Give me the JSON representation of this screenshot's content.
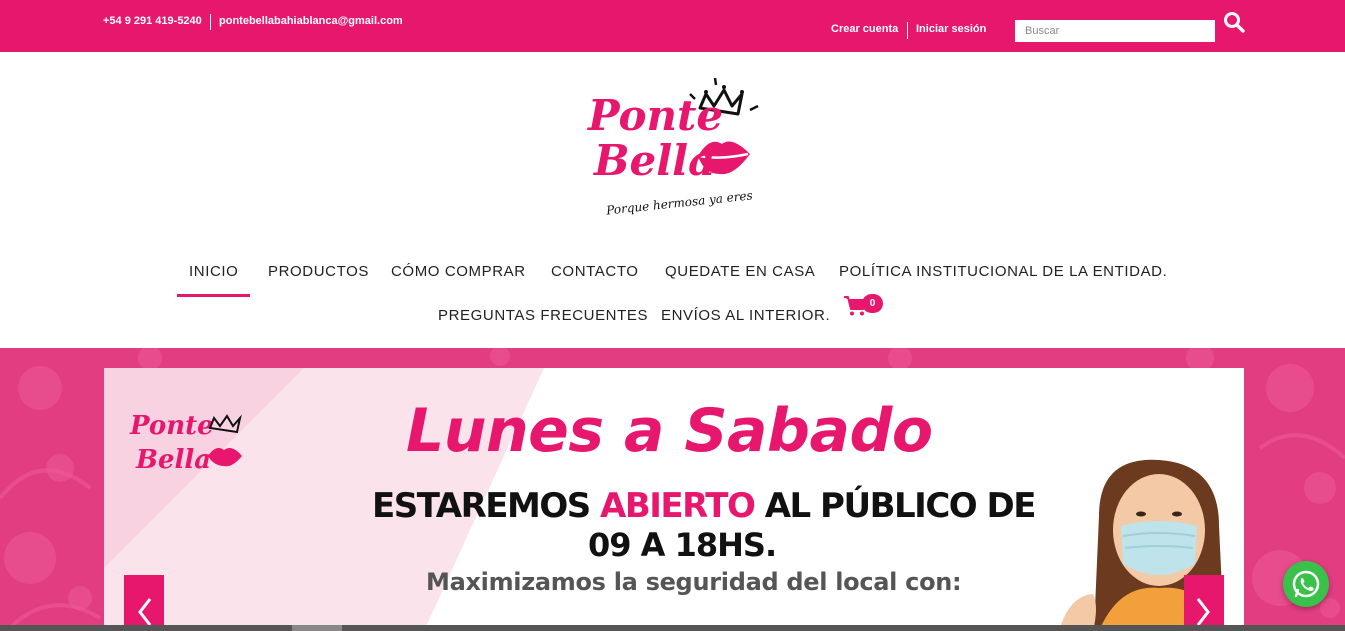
{
  "topbar": {
    "phone": "+54 9 291 419-5240",
    "email": "pontebellabahiablanca@gmail.com",
    "create_account": "Crear cuenta",
    "login": "Iniciar sesión",
    "search_placeholder": "Buscar",
    "search_icon": "search-icon"
  },
  "logo": {
    "line1": "Ponte",
    "line2": "Bella",
    "tagline": "Porque hermosa ya eres"
  },
  "nav": {
    "items": [
      {
        "label": "INICIO",
        "active": true
      },
      {
        "label": "PRODUCTOS"
      },
      {
        "label": "CÓMO COMPRAR"
      },
      {
        "label": "CONTACTO"
      },
      {
        "label": "QUEDATE EN CASA"
      },
      {
        "label": "POLÍTICA INSTITUCIONAL DE LA ENTIDAD."
      },
      {
        "label": "PREGUNTAS FRECUENTES"
      },
      {
        "label": "ENVÍOS AL INTERIOR."
      }
    ],
    "cart_count": "0",
    "cart_icon": "cart-icon"
  },
  "hero": {
    "title": "Lunes a Sabado",
    "line1_a": "ESTAREMOS ",
    "line1_b": "ABIERTO",
    "line1_c": " AL PÚBLICO DE",
    "line2": "09 A 18HS.",
    "line3": "Maximizamos la seguridad del local con:",
    "logo_line1": "Ponte",
    "logo_line2": "Bella"
  },
  "colors": {
    "brand_pink": "#e8176e",
    "hero_pink": "#e23d81",
    "whatsapp_green": "#39c14a"
  }
}
